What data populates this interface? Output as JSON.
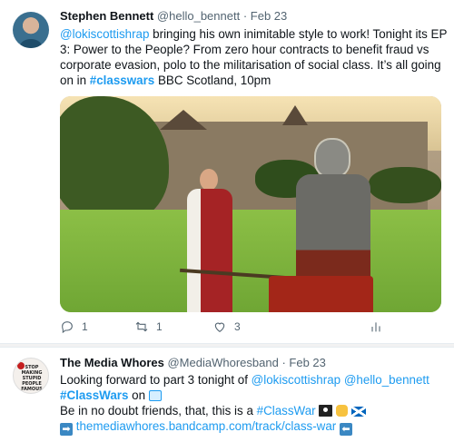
{
  "tweet1": {
    "name": "Stephen Bennett",
    "handle": "@hello_bennett",
    "separator": "·",
    "date": "Feb 23",
    "lines": [
      {
        "mention": "@lokiscottishrap",
        "text": " bringing his own inimitable style to work! Tonight its EP"
      },
      {
        "text": "3: Power to the People?  From zero hour contracts to benefit fraud vs"
      },
      {
        "text": "corporate evasion, polo to the militarisation of social class. It’s all going"
      },
      {
        "pre": "on in ",
        "hashtag": "#classwars",
        "post": " BBC Scotland, 10pm"
      }
    ],
    "actions": {
      "reply_count": "1",
      "retweet_count": "1",
      "like_count": "3"
    }
  },
  "tweet2": {
    "name": "The Media Whores",
    "handle": "@MediaWhoresband",
    "separator": "·",
    "date": "Feb 23",
    "line1_pre": "Looking forward to part 3 tonight of ",
    "line1_mention1": "@lokiscottishrap",
    "line1_space": " ",
    "line1_mention2": "@hello_bennett",
    "line2_hashtag": "#ClassWars",
    "line2_post": " on ",
    "line3_pre": "Be in no doubt friends, that, this is a ",
    "line3_hashtag": "#ClassWar",
    "line4_arrow_left": "➡",
    "line4_link": "themediawhores.bandcamp.com/track/class-war",
    "line4_arrow_right": "⬅",
    "avatar_text": "STOP MAKING STUPID PEOPLE FAMOUS"
  },
  "icons": [
    "reply-icon",
    "retweet-icon",
    "like-icon",
    "analytics-icon",
    "tv-emoji",
    "pirate-flag-emoji",
    "raised-fist-emoji",
    "scotland-flag-emoji",
    "right-arrow-emoji",
    "left-arrow-emoji"
  ],
  "colors": {
    "link": "#1d9bf0",
    "muted": "#536471",
    "text": "#0f1419"
  }
}
